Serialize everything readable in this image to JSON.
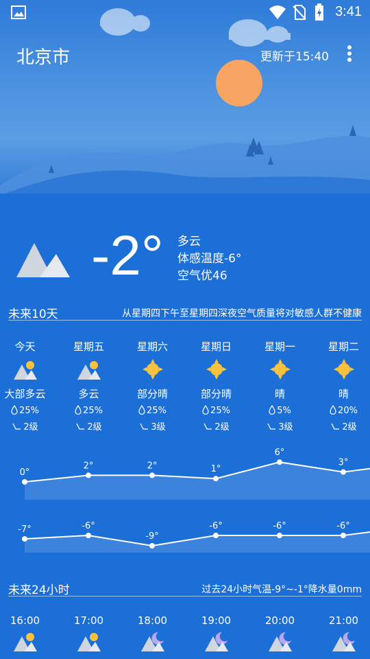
{
  "status": {
    "time": "3:41"
  },
  "header": {
    "city": "北京市",
    "updated": "更新于15:40"
  },
  "current": {
    "temp": "-2°",
    "condition": "多云",
    "feels_like": "体感温度-6°",
    "air_quality": "空气优46"
  },
  "forecast10": {
    "title": "未来10天",
    "note": "从星期四下午至星期四深夜空气质量将对敏感人群不健康",
    "days": [
      {
        "name": "今天",
        "icon": "partly-cloudy-icon",
        "cond": "大部多云",
        "pop": "25%",
        "wind": "2级"
      },
      {
        "name": "星期五",
        "icon": "partly-cloudy-icon",
        "cond": "多云",
        "pop": "25%",
        "wind": "2级"
      },
      {
        "name": "星期六",
        "icon": "sun-icon",
        "cond": "部分晴",
        "pop": "25%",
        "wind": "3级"
      },
      {
        "name": "星期日",
        "icon": "sun-icon",
        "cond": "部分晴",
        "pop": "25%",
        "wind": "2级"
      },
      {
        "name": "星期一",
        "icon": "sun-icon",
        "cond": "晴",
        "pop": "5%",
        "wind": "3级"
      },
      {
        "name": "星期二",
        "icon": "sun-icon",
        "cond": "晴",
        "pop": "20%",
        "wind": "2级"
      }
    ]
  },
  "chart_data": {
    "type": "line",
    "categories": [
      "今天",
      "星期五",
      "星期六",
      "星期日",
      "星期一",
      "星期二"
    ],
    "series": [
      {
        "values": [
          0,
          2,
          2,
          1,
          6,
          3
        ],
        "labels": [
          "0°",
          "2°",
          "2°",
          "1°",
          "6°",
          "3°"
        ]
      },
      {
        "values": [
          -7,
          -6,
          -9,
          -6,
          -6,
          -6
        ],
        "labels": [
          "-7°",
          "-6°",
          "-9°",
          "-6°",
          "-6°",
          "-6°"
        ]
      }
    ]
  },
  "forecast24": {
    "title": "未来24小时",
    "note": "过去24小时气温-9°~-1°降水量0mm",
    "hours": [
      {
        "time": "16:00",
        "icon": "partly-cloudy-icon"
      },
      {
        "time": "17:00",
        "icon": "partly-cloudy-icon"
      },
      {
        "time": "18:00",
        "icon": "cloudy-night-icon"
      },
      {
        "time": "19:00",
        "icon": "cloudy-night-icon"
      },
      {
        "time": "20:00",
        "icon": "cloudy-night-icon"
      },
      {
        "time": "21:00",
        "icon": "cloudy-night-icon"
      }
    ]
  }
}
